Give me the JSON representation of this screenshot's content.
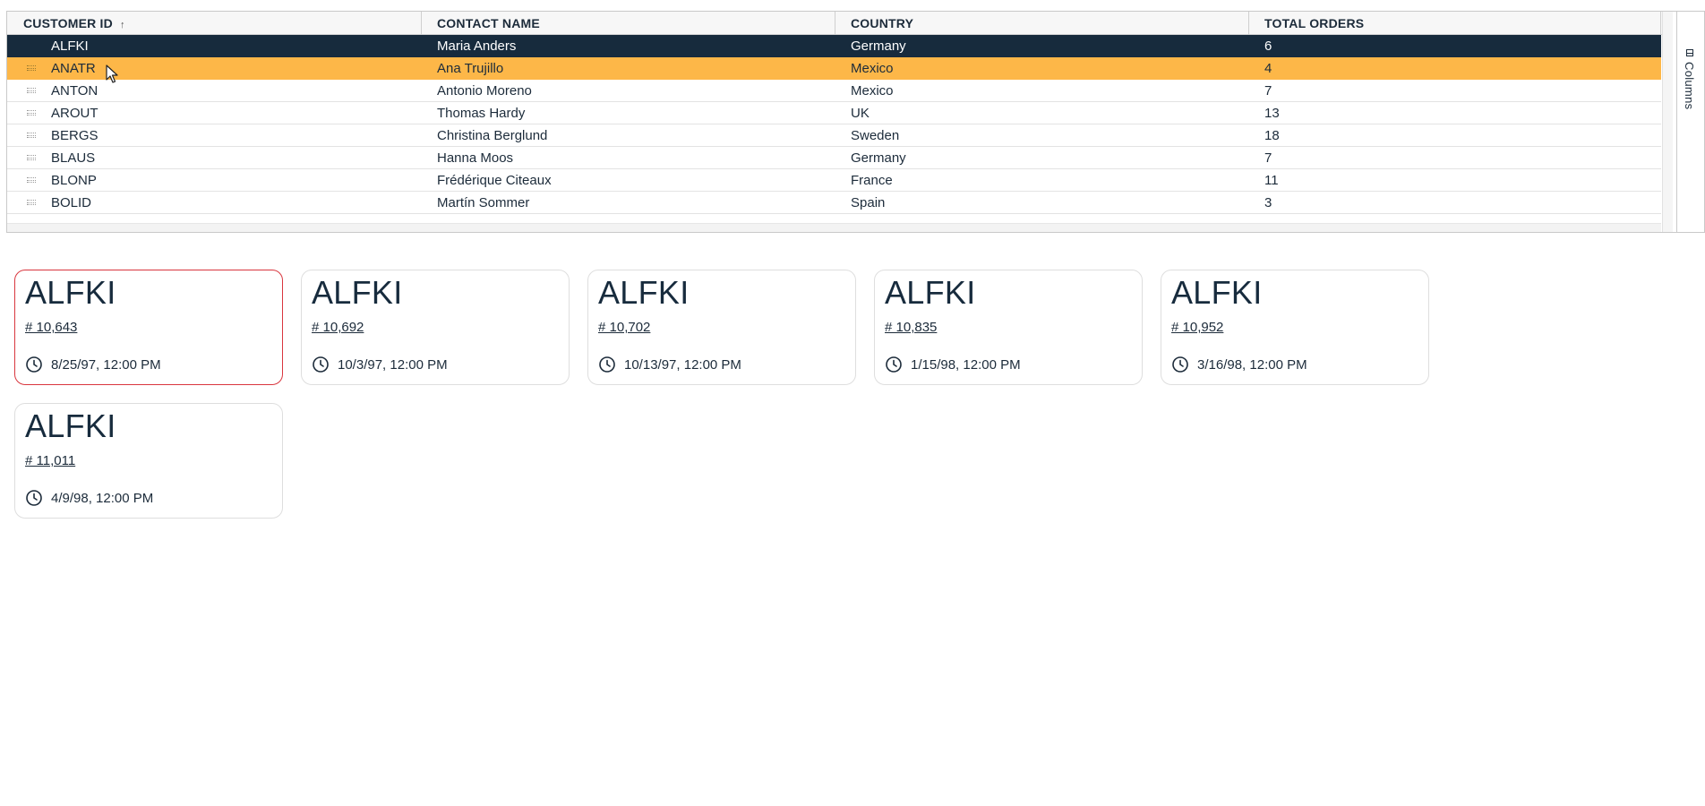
{
  "grid": {
    "columns": [
      {
        "label": "CUSTOMER ID",
        "sort": "ascending"
      },
      {
        "label": "CONTACT NAME"
      },
      {
        "label": "COUNTRY"
      },
      {
        "label": "TOTAL ORDERS"
      }
    ],
    "sort_icon": "↑",
    "rows": [
      {
        "id": "ALFKI",
        "contact": "Maria Anders",
        "country": "Germany",
        "orders": "6",
        "state": "selected"
      },
      {
        "id": "ANATR",
        "contact": "Ana Trujillo",
        "country": "Mexico",
        "orders": "4",
        "state": "hovered"
      },
      {
        "id": "ANTON",
        "contact": "Antonio Moreno",
        "country": "Mexico",
        "orders": "7",
        "state": ""
      },
      {
        "id": "AROUT",
        "contact": "Thomas Hardy",
        "country": "UK",
        "orders": "13",
        "state": ""
      },
      {
        "id": "BERGS",
        "contact": "Christina Berglund",
        "country": "Sweden",
        "orders": "18",
        "state": ""
      },
      {
        "id": "BLAUS",
        "contact": "Hanna Moos",
        "country": "Germany",
        "orders": "7",
        "state": ""
      },
      {
        "id": "BLONP",
        "contact": "Frédérique Citeaux",
        "country": "France",
        "orders": "11",
        "state": ""
      },
      {
        "id": "BOLID",
        "contact": "Martín Sommer",
        "country": "Spain",
        "orders": "3",
        "state": ""
      }
    ],
    "side_panel": {
      "label": "Columns",
      "icon": "columns-icon"
    }
  },
  "cards": [
    {
      "title": "ALFKI",
      "order": "# 10,643",
      "date": "8/25/97, 12:00 PM",
      "active": true
    },
    {
      "title": "ALFKI",
      "order": "# 10,692",
      "date": "10/3/97, 12:00 PM",
      "active": false
    },
    {
      "title": "ALFKI",
      "order": "# 10,702",
      "date": "10/13/97, 12:00 PM",
      "active": false
    },
    {
      "title": "ALFKI",
      "order": "# 10,835",
      "date": "1/15/98, 12:00 PM",
      "active": false
    },
    {
      "title": "ALFKI",
      "order": "# 10,952",
      "date": "3/16/98, 12:00 PM",
      "active": false
    },
    {
      "title": "ALFKI",
      "order": "# 11,011",
      "date": "4/9/98, 12:00 PM",
      "active": false
    }
  ],
  "colors": {
    "selected_row": "#172b3d",
    "hover_row": "#fdb748",
    "active_card_border": "#d9363e",
    "text": "#1c2b3a"
  }
}
